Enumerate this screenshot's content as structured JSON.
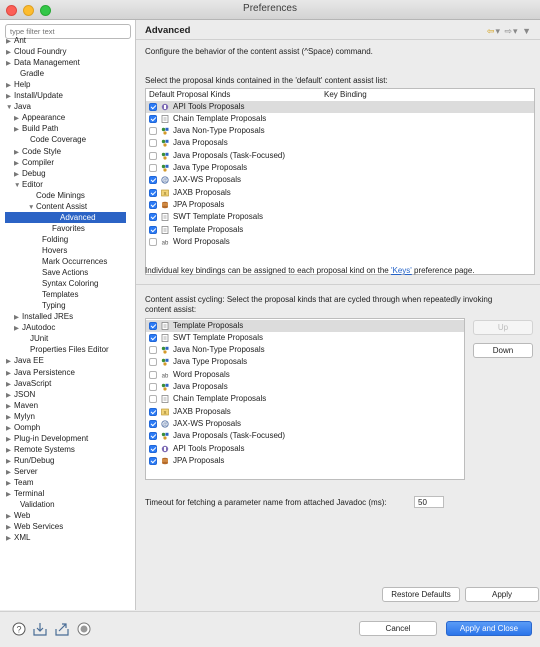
{
  "window": {
    "title": "Preferences"
  },
  "filter": {
    "placeholder": "type filter text"
  },
  "tree": [
    {
      "label": "Ant",
      "arrow": "▶"
    },
    {
      "label": "Cloud Foundry",
      "arrow": "▶"
    },
    {
      "label": "Data Management",
      "arrow": "▶"
    },
    {
      "label": "Gradle",
      "arrow": ""
    },
    {
      "label": "Help",
      "arrow": "▶"
    },
    {
      "label": "Install/Update",
      "arrow": "▶"
    },
    {
      "label": "Java",
      "arrow": "▼"
    },
    {
      "label": "Appearance",
      "arrow": "▶"
    },
    {
      "label": "Build Path",
      "arrow": "▶"
    },
    {
      "label": "Code Coverage",
      "arrow": ""
    },
    {
      "label": "Code Style",
      "arrow": "▶"
    },
    {
      "label": "Compiler",
      "arrow": "▶"
    },
    {
      "label": "Debug",
      "arrow": "▶"
    },
    {
      "label": "Editor",
      "arrow": "▼"
    },
    {
      "label": "Code Minings",
      "arrow": ""
    },
    {
      "label": "Content Assist",
      "arrow": "▼"
    },
    {
      "label": "Advanced",
      "arrow": ""
    },
    {
      "label": "Favorites",
      "arrow": ""
    },
    {
      "label": "Folding",
      "arrow": ""
    },
    {
      "label": "Hovers",
      "arrow": ""
    },
    {
      "label": "Mark Occurrences",
      "arrow": ""
    },
    {
      "label": "Save Actions",
      "arrow": ""
    },
    {
      "label": "Syntax Coloring",
      "arrow": ""
    },
    {
      "label": "Templates",
      "arrow": ""
    },
    {
      "label": "Typing",
      "arrow": ""
    },
    {
      "label": "Installed JREs",
      "arrow": "▶"
    },
    {
      "label": "JAutodoc",
      "arrow": "▶"
    },
    {
      "label": "JUnit",
      "arrow": ""
    },
    {
      "label": "Properties Files Editor",
      "arrow": ""
    },
    {
      "label": "Java EE",
      "arrow": "▶"
    },
    {
      "label": "Java Persistence",
      "arrow": "▶"
    },
    {
      "label": "JavaScript",
      "arrow": "▶"
    },
    {
      "label": "JSON",
      "arrow": "▶"
    },
    {
      "label": "Maven",
      "arrow": "▶"
    },
    {
      "label": "Mylyn",
      "arrow": "▶"
    },
    {
      "label": "Oomph",
      "arrow": "▶"
    },
    {
      "label": "Plug-in Development",
      "arrow": "▶"
    },
    {
      "label": "Remote Systems",
      "arrow": "▶"
    },
    {
      "label": "Run/Debug",
      "arrow": "▶"
    },
    {
      "label": "Server",
      "arrow": "▶"
    },
    {
      "label": "Team",
      "arrow": "▶"
    },
    {
      "label": "Terminal",
      "arrow": "▶"
    },
    {
      "label": "Validation",
      "arrow": ""
    },
    {
      "label": "Web",
      "arrow": "▶"
    },
    {
      "label": "Web Services",
      "arrow": "▶"
    },
    {
      "label": "XML",
      "arrow": "▶"
    }
  ],
  "page": {
    "title": "Advanced",
    "description": "Configure the behavior of the content assist (^Space) command.",
    "list1_caption": "Select the proposal kinds contained in the 'default' content assist list:",
    "col_kinds": "Default Proposal Kinds",
    "col_binding": "Key Binding",
    "list1": [
      {
        "label": "API Tools Proposals",
        "checked": true
      },
      {
        "label": "Chain Template Proposals",
        "checked": true
      },
      {
        "label": "Java Non-Type Proposals",
        "checked": false
      },
      {
        "label": "Java Proposals",
        "checked": false
      },
      {
        "label": "Java Proposals (Task-Focused)",
        "checked": false
      },
      {
        "label": "Java Type Proposals",
        "checked": false
      },
      {
        "label": "JAX-WS Proposals",
        "checked": true
      },
      {
        "label": "JAXB Proposals",
        "checked": true
      },
      {
        "label": "JPA Proposals",
        "checked": true
      },
      {
        "label": "SWT Template Proposals",
        "checked": true
      },
      {
        "label": "Template Proposals",
        "checked": true
      },
      {
        "label": "Word Proposals",
        "checked": false
      }
    ],
    "keys_note_pre": "Individual key bindings can be assigned to each proposal kind on the ",
    "keys_link": "'Keys'",
    "keys_note_post": " preference page.",
    "cycling_caption_1": "Content assist cycling: Select the proposal kinds that are cycled through when repeatedly invoking",
    "cycling_caption_2": "content assist:",
    "list2": [
      {
        "label": "Template Proposals",
        "checked": true
      },
      {
        "label": "SWT Template Proposals",
        "checked": true
      },
      {
        "label": "Java Non-Type Proposals",
        "checked": false
      },
      {
        "label": "Java Type Proposals",
        "checked": false
      },
      {
        "label": "Word Proposals",
        "checked": false
      },
      {
        "label": "Java Proposals",
        "checked": false
      },
      {
        "label": "Chain Template Proposals",
        "checked": false
      },
      {
        "label": "JAXB Proposals",
        "checked": true
      },
      {
        "label": "JAX-WS Proposals",
        "checked": true
      },
      {
        "label": "Java Proposals (Task-Focused)",
        "checked": true
      },
      {
        "label": "API Tools Proposals",
        "checked": true
      },
      {
        "label": "JPA Proposals",
        "checked": true
      }
    ],
    "up_label": "Up",
    "down_label": "Down",
    "timeout_label": "Timeout for fetching a parameter name from attached Javadoc (ms):",
    "timeout_value": "50",
    "restore_label": "Restore Defaults",
    "apply_label": "Apply"
  },
  "footer": {
    "cancel_label": "Cancel",
    "apply_close_label": "Apply and Close"
  },
  "icons": {
    "help": "help-icon",
    "import": "import-icon",
    "export": "export-icon",
    "record": "record-icon"
  }
}
